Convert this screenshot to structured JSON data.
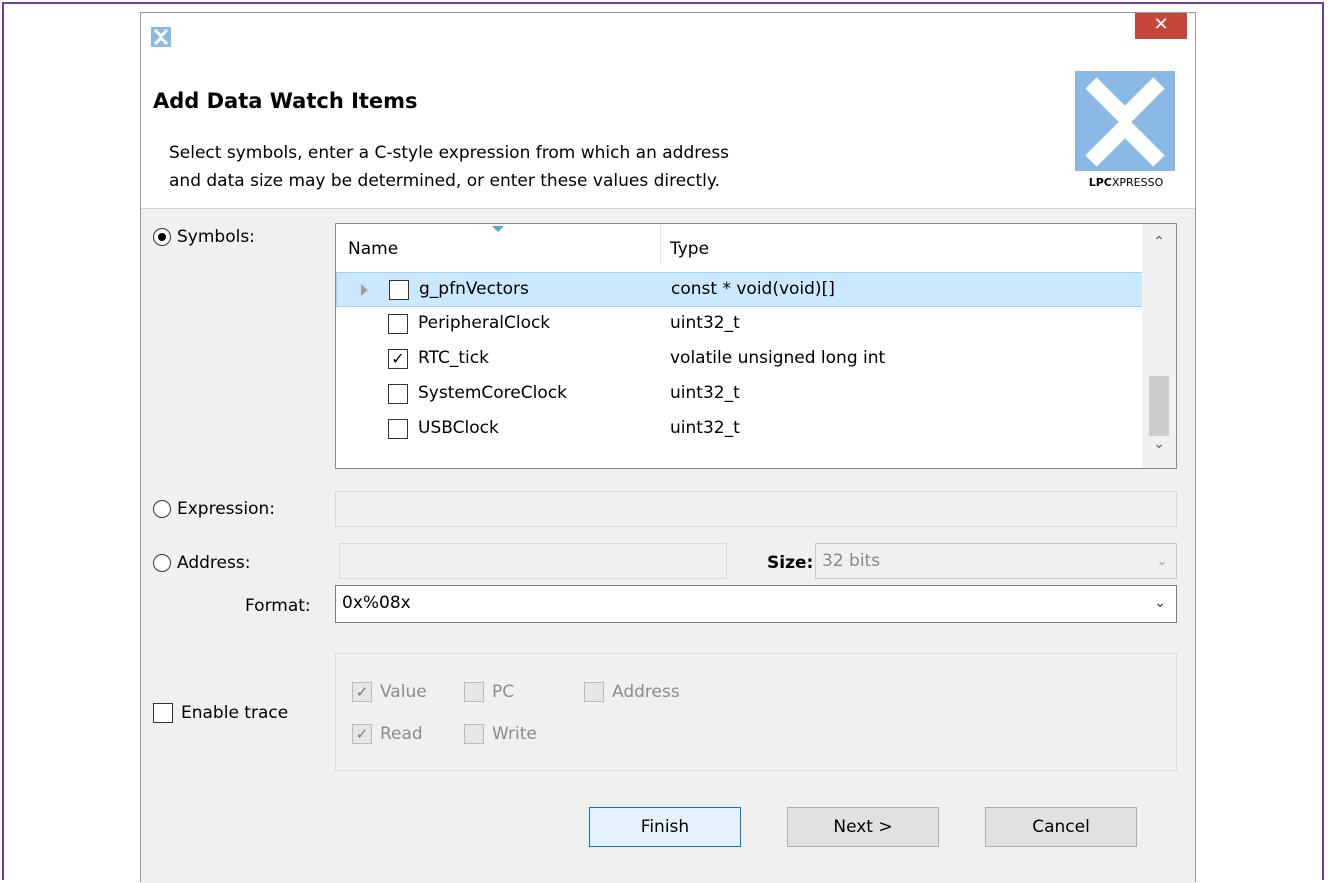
{
  "window": {
    "close_glyph": "✕"
  },
  "header": {
    "title": "Add Data Watch Items",
    "description_line1": "Select symbols, enter a C-style expression from which an address",
    "description_line2": "and data size may be determined, or enter these values directly.",
    "logo_text_bold": "LPC",
    "logo_text_rest": "XPRESSO",
    "logo_color": "#8ab9e5"
  },
  "modes": {
    "symbols_label": "Symbols:",
    "expression_label": "Expression:",
    "address_label": "Address:",
    "selected": "symbols"
  },
  "symbols_table": {
    "columns": [
      "Name",
      "Type"
    ],
    "rows": [
      {
        "name": "g_pfnVectors",
        "type": "const  * void(void)[]",
        "checked": false,
        "selected": true,
        "expandable": true
      },
      {
        "name": "PeripheralClock",
        "type": "uint32_t",
        "checked": false,
        "selected": false,
        "expandable": false
      },
      {
        "name": "RTC_tick",
        "type": "volatile unsigned long int",
        "checked": true,
        "selected": false,
        "expandable": false
      },
      {
        "name": "SystemCoreClock",
        "type": "uint32_t",
        "checked": false,
        "selected": false,
        "expandable": false
      },
      {
        "name": "USBClock",
        "type": "uint32_t",
        "checked": false,
        "selected": false,
        "expandable": false
      }
    ]
  },
  "expression": {
    "value": ""
  },
  "address": {
    "value": "",
    "size_label": "Size:",
    "size_value": "32 bits"
  },
  "format": {
    "label": "Format:",
    "value": "0x%08x"
  },
  "trace": {
    "enable_label": "Enable trace",
    "enabled": false,
    "options": {
      "value_label": "Value",
      "value_checked": true,
      "pc_label": "PC",
      "pc_checked": false,
      "address_label": "Address",
      "address_checked": false,
      "read_label": "Read",
      "read_checked": true,
      "write_label": "Write",
      "write_checked": false
    }
  },
  "buttons": {
    "finish": "Finish",
    "next": "Next >",
    "cancel": "Cancel"
  },
  "icons": {
    "check": "✓",
    "chevron_down": "⌄",
    "scroll_up": "⌃",
    "scroll_down": "⌄"
  }
}
